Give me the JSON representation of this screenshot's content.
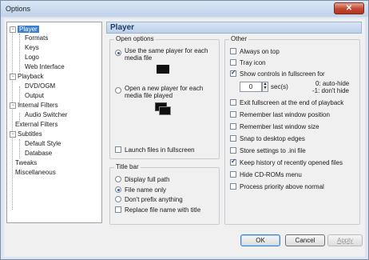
{
  "window": {
    "title": "Options",
    "close_symbol": "✕"
  },
  "tree": {
    "items": [
      {
        "label": "Player",
        "selected": true,
        "expander": "−"
      },
      {
        "label": "Formats"
      },
      {
        "label": "Keys"
      },
      {
        "label": "Logo"
      },
      {
        "label": "Web Interface"
      },
      {
        "label": "Playback",
        "expander": "−"
      },
      {
        "label": "DVD/OGM"
      },
      {
        "label": "Output"
      },
      {
        "label": "Internal Filters",
        "expander": "−"
      },
      {
        "label": "Audio Switcher"
      },
      {
        "label": "External Filters"
      },
      {
        "label": "Subtitles",
        "expander": "−"
      },
      {
        "label": "Default Style"
      },
      {
        "label": "Database"
      },
      {
        "label": "Tweaks"
      },
      {
        "label": "Miscellaneous"
      }
    ]
  },
  "panel": {
    "title": "Player"
  },
  "open_options": {
    "label": "Open options",
    "same_player": "Use the same player for each media file",
    "new_player": "Open a new player for each media file played",
    "launch_fullscreen": "Launch files in fullscreen"
  },
  "title_bar": {
    "label": "Title bar",
    "full_path": "Display full path",
    "file_name_only": "File name only",
    "dont_prefix": "Don't prefix anything",
    "replace_title": "Replace file name with title"
  },
  "other": {
    "label": "Other",
    "always_on_top": "Always on top",
    "tray_icon": "Tray icon",
    "show_controls": "Show controls in fullscreen for",
    "seconds_value": "0",
    "seconds_unit": "sec(s)",
    "hint_line1": "0: auto-hide",
    "hint_line2": "-1: don't hide",
    "exit_fullscreen": "Exit fullscreen at the end of playback",
    "remember_position": "Remember last window position",
    "remember_size": "Remember last window size",
    "snap_edges": "Snap to desktop edges",
    "store_ini": "Store settings to .ini file",
    "keep_history": "Keep history of recently opened files",
    "hide_cdrom": "Hide CD-ROMs menu",
    "process_priority": "Process priority above normal"
  },
  "buttons": {
    "ok": "OK",
    "cancel": "Cancel",
    "apply": "Apply"
  }
}
